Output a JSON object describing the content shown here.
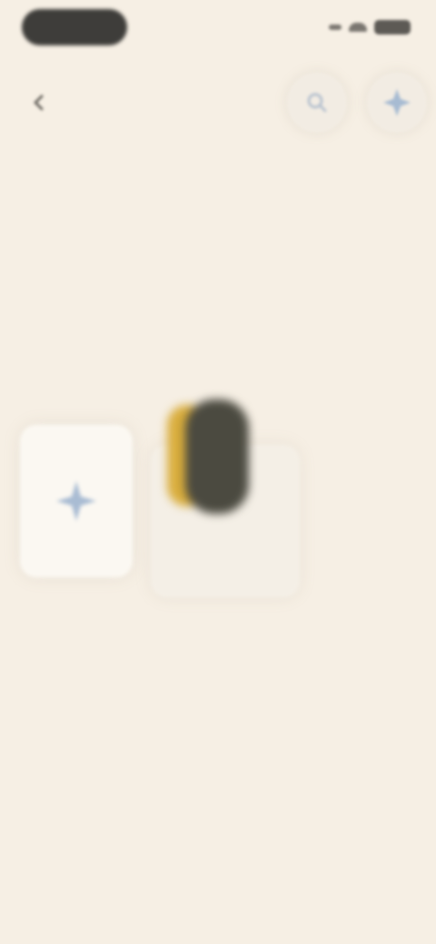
{
  "header": {
    "back_icon": "chevron-left-icon",
    "search_icon": "search-icon",
    "favorite_icon": "sparkle-icon"
  },
  "page": {
    "title": "",
    "subtitle": "",
    "prompt_line_1": "",
    "prompt_line_2": ""
  },
  "cards": [
    {
      "type": "add",
      "icon": "plus-sparkle-icon"
    },
    {
      "type": "product",
      "name": "",
      "meta": "",
      "colors": [
        "#d9ad3c",
        "#4b4a40"
      ]
    }
  ],
  "colors": {
    "background": "#f6efe4",
    "accent": "#9fb5cf",
    "dark": "#3e3d3a"
  }
}
